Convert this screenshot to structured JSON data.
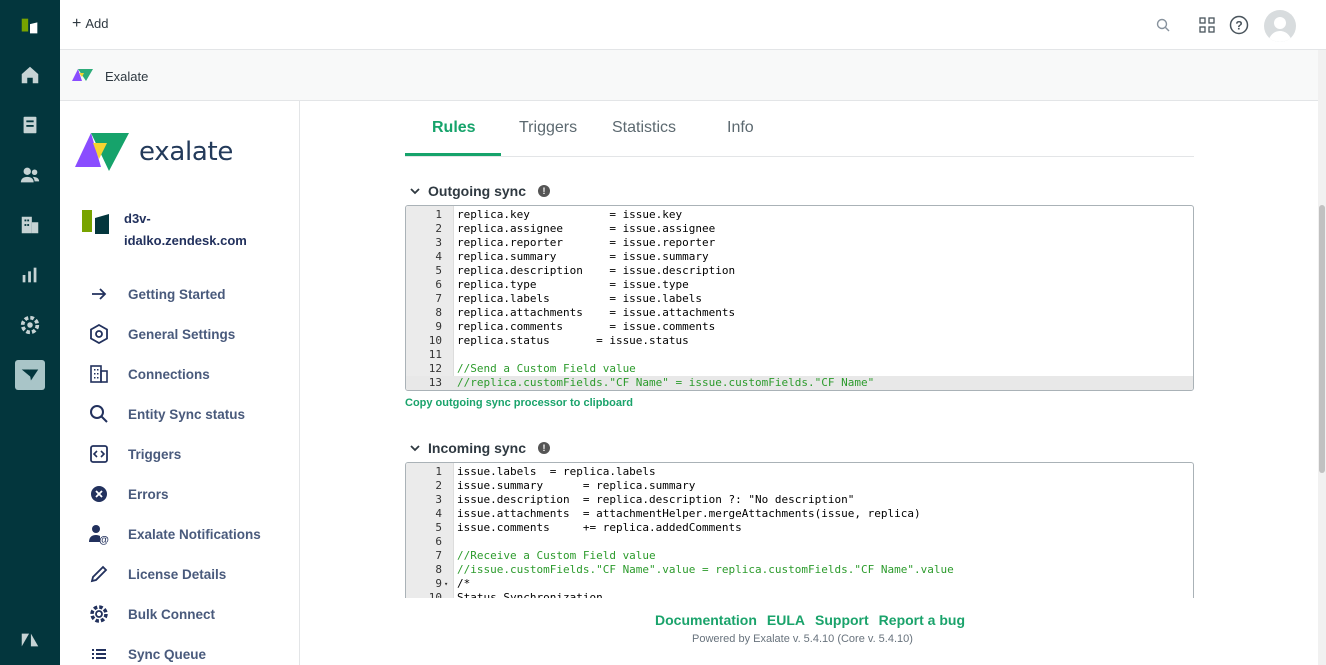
{
  "topbar": {
    "add_label": "Add"
  },
  "appbar": {
    "title": "Exalate"
  },
  "sidebar": {
    "brand": "exalate",
    "instance": "d3v-idalko.zendesk.com",
    "items": [
      {
        "label": "Getting Started",
        "icon": "arrow-right-icon"
      },
      {
        "label": "General Settings",
        "icon": "hexagon-settings-icon"
      },
      {
        "label": "Connections",
        "icon": "building-icon"
      },
      {
        "label": "Entity Sync status",
        "icon": "search-icon"
      },
      {
        "label": "Triggers",
        "icon": "code-brackets-icon"
      },
      {
        "label": "Errors",
        "icon": "error-x-icon"
      },
      {
        "label": "Exalate Notifications",
        "icon": "user-at-icon"
      },
      {
        "label": "License Details",
        "icon": "pencil-icon"
      },
      {
        "label": "Bulk Connect",
        "icon": "gear-icon"
      },
      {
        "label": "Sync Queue",
        "icon": "list-icon"
      }
    ]
  },
  "tabs": [
    "Rules",
    "Triggers",
    "Statistics",
    "Info"
  ],
  "outgoing": {
    "title": "Outgoing sync",
    "copy_label": "Copy outgoing sync processor to clipboard",
    "lines": [
      "replica.key            = issue.key",
      "replica.assignee       = issue.assignee",
      "replica.reporter       = issue.reporter",
      "replica.summary        = issue.summary",
      "replica.description    = issue.description",
      "replica.type           = issue.type",
      "replica.labels         = issue.labels",
      "replica.attachments    = issue.attachments",
      "replica.comments       = issue.comments",
      "replica.status       = issue.status",
      "",
      "//Send a Custom Field value",
      "//replica.customFields.\"CF Name\" = issue.customFields.\"CF Name\""
    ]
  },
  "incoming": {
    "title": "Incoming sync",
    "lines": [
      "issue.labels  = replica.labels",
      "issue.summary      = replica.summary",
      "issue.description  = replica.description ?: \"No description\"",
      "issue.attachments  = attachmentHelper.mergeAttachments(issue, replica)",
      "issue.comments     += replica.addedComments",
      "",
      "//Receive a Custom Field value",
      "//issue.customFields.\"CF Name\".value = replica.customFields.\"CF Name\".value",
      "/*",
      "Status Synchronization"
    ]
  },
  "footer": {
    "links": [
      "Documentation",
      "EULA",
      "Support",
      "Report a bug"
    ],
    "powered": "Powered by Exalate v. 5.4.10 (Core v. 5.4.10)"
  },
  "colors": {
    "rail": "#03363d",
    "accent": "#16a36b",
    "brand_purple": "#8a4dff",
    "brand_yellow": "#f6d431"
  }
}
